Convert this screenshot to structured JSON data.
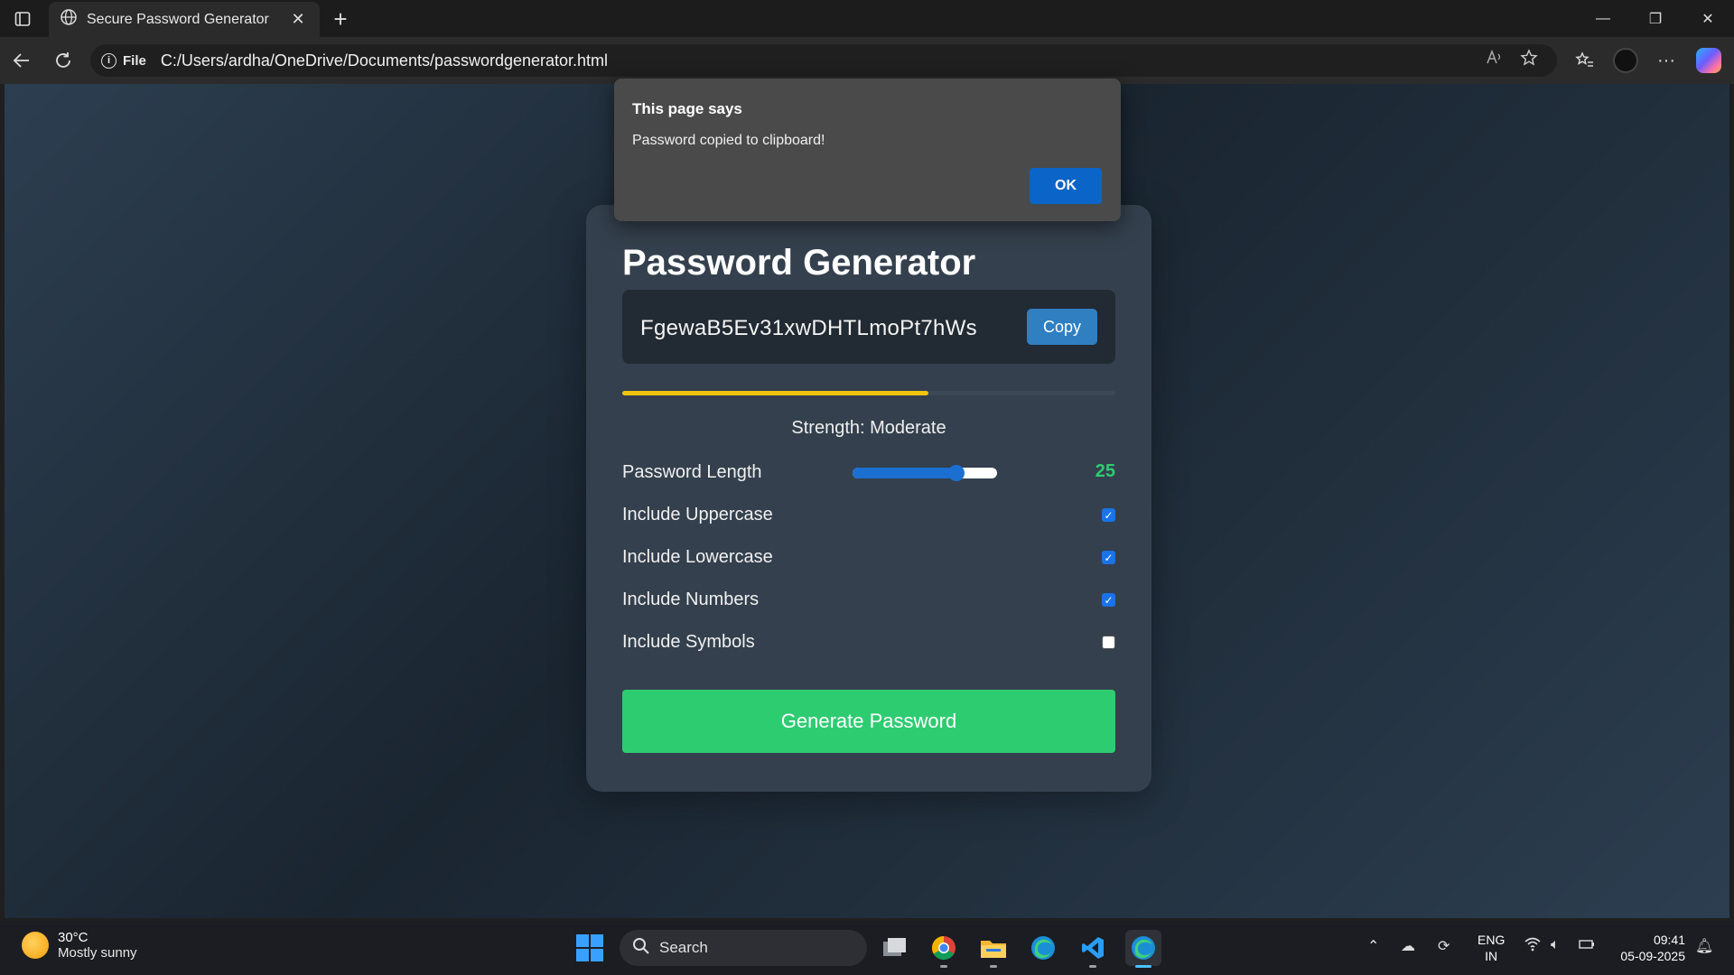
{
  "browser": {
    "tab_title": "Secure Password Generator",
    "address_prefix": "File",
    "url": "C:/Users/ardha/OneDrive/Documents/passwordgenerator.html"
  },
  "app": {
    "heading": "Password Generator",
    "password": "FgewaB5Ev31xwDHTLmoPt7hWs",
    "copy_label": "Copy",
    "strength_text": "Strength: Moderate",
    "strength_fraction": 0.62,
    "strength_color": "#f1c40f",
    "options": {
      "length_label": "Password Length",
      "length_value": "25",
      "length_fraction": 0.72,
      "uppercase_label": "Include Uppercase",
      "uppercase_checked": true,
      "lowercase_label": "Include Lowercase",
      "lowercase_checked": true,
      "numbers_label": "Include Numbers",
      "numbers_checked": true,
      "symbols_label": "Include Symbols",
      "symbols_checked": false
    },
    "generate_label": "Generate Password",
    "accent_color": "#2ecc71"
  },
  "dialog": {
    "title": "This page says",
    "message": "Password copied to clipboard!",
    "ok_label": "OK"
  },
  "taskbar": {
    "temperature": "30°C",
    "weather": "Mostly sunny",
    "search_label": "Search",
    "lang_line1": "ENG",
    "lang_line2": "IN",
    "time": "09:41",
    "date": "05-09-2025"
  }
}
